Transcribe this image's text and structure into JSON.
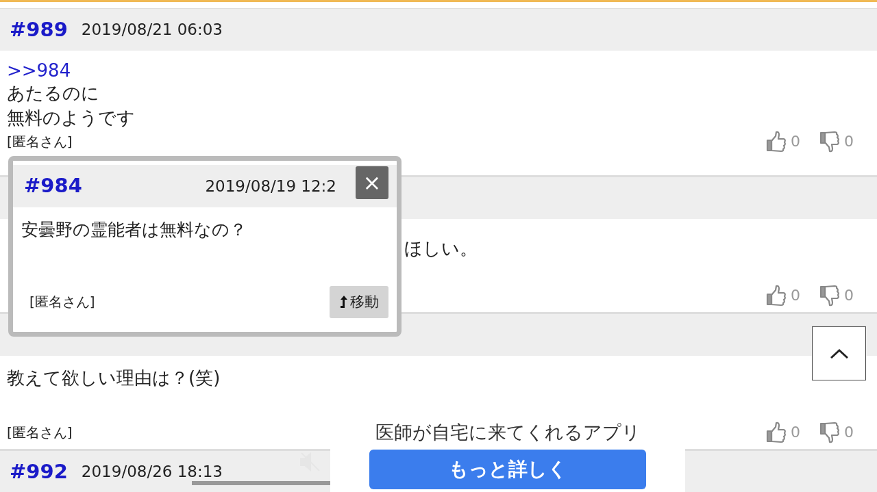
{
  "posts": [
    {
      "number": "#989",
      "date": "2019/08/21 06:03",
      "reply_to": ">>984",
      "lines": [
        "あたるのに",
        "無料のようです"
      ],
      "author": "[匿名さん]",
      "likes": "0",
      "dislikes": "0"
    },
    {
      "body_tail": "ほしい。",
      "likes": "0",
      "dislikes": "0"
    },
    {
      "lines": [
        "教えて欲しい理由は？(笑)"
      ],
      "author": "[匿名さん]",
      "likes": "0",
      "dislikes": "0"
    },
    {
      "number": "#992",
      "date": "2019/08/26 18:13"
    }
  ],
  "popup": {
    "number": "#984",
    "date": "2019/08/19 12:2",
    "body": "安曇野の霊能者は無料なの？",
    "author": "[匿名さん]",
    "move_button": "移動",
    "close": "×"
  },
  "video_progress": {
    "level": 1.0
  },
  "ad": {
    "text": "医師が自宅に来てくれるアプリ",
    "button": "もっと詳しく"
  }
}
